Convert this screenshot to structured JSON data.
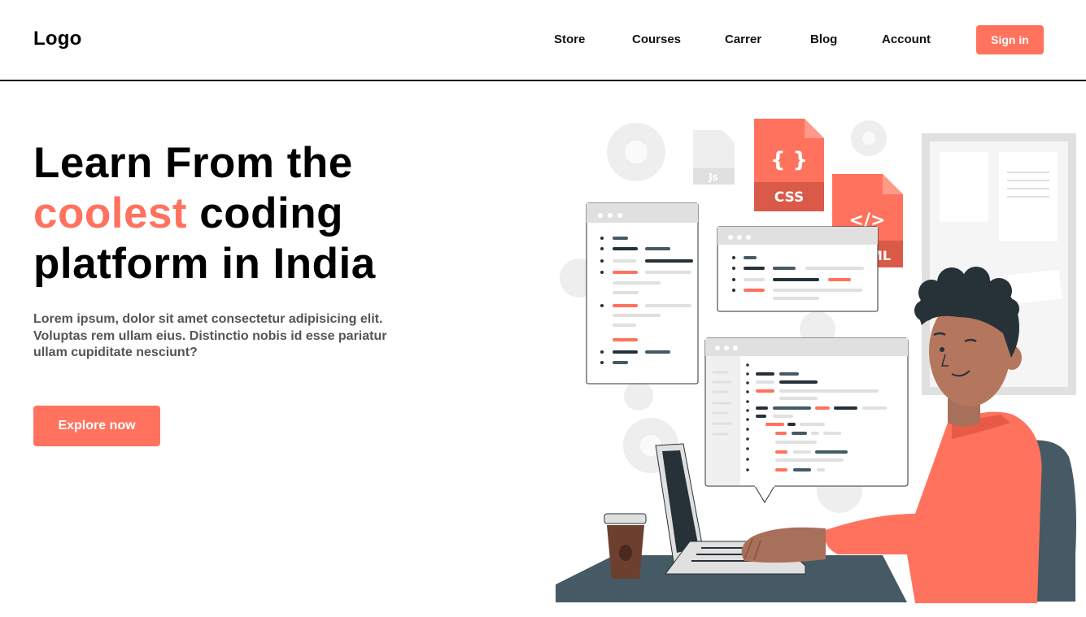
{
  "header": {
    "logo": "Logo",
    "nav": [
      "Store",
      "Courses",
      "Carrer",
      "Blog",
      "Account"
    ],
    "signin_label": "Sign in"
  },
  "hero": {
    "title_line1": "Learn From the",
    "title_accent": "coolest",
    "title_line2_rest": " coding",
    "title_line3": "platform in India",
    "description": "Lorem ipsum, dolor sit amet consectetur adipisicing elit. Voluptas rem ullam eius. Distinctio nobis id esse pariatur ullam cupiditate nesciunt?",
    "cta_label": "Explore now"
  },
  "illustration": {
    "css_label": "CSS",
    "css_braces": "{ }",
    "html_tag": "</>",
    "html_label_fragment": "ML",
    "js_label": "Js"
  },
  "colors": {
    "accent": "#ff725e",
    "dark": "#263238",
    "slate": "#455a64"
  }
}
